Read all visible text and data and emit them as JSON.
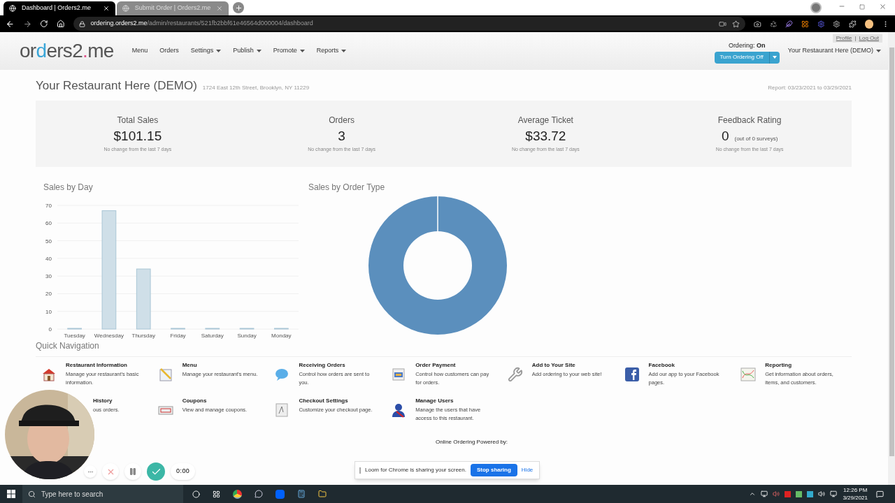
{
  "browser": {
    "tabs": [
      {
        "title": "Dashboard | Orders2.me",
        "selected": true
      },
      {
        "title": "Submit Order | Orders2.me",
        "selected": false
      }
    ],
    "url_host": "ordering.orders2.me",
    "url_path": "/admin/restaurants/521fb2bbf61e46564d000004/dashboard"
  },
  "header": {
    "logo_parts": [
      "or",
      "d",
      "ers2",
      ".",
      "me"
    ],
    "nav": [
      "Menu",
      "Orders",
      "Settings",
      "Publish",
      "Promote",
      "Reports"
    ],
    "nav_dropdown": [
      false,
      false,
      true,
      true,
      true,
      true
    ],
    "account_links": [
      "Profile",
      "Log Out"
    ],
    "account_separator": "|",
    "ordering_label": "Ordering:",
    "ordering_state": "On",
    "toggle_button": "Turn Ordering Off",
    "restaurant_menu": "Your Restaurant Here (DEMO)"
  },
  "restaurant": {
    "name": "Your Restaurant Here (DEMO)",
    "address": "1724 East 12th Street, Brooklyn, NY 11229",
    "report_range": "Report: 03/23/2021 to 03/29/2021"
  },
  "stats": [
    {
      "label": "Total Sales",
      "value": "$101.15",
      "note": "No change from the last 7 days"
    },
    {
      "label": "Orders",
      "value": "3",
      "note": "No change from the last 7 days"
    },
    {
      "label": "Average Ticket",
      "value": "$33.72",
      "note": "No change from the last 7 days"
    },
    {
      "label": "Feedback Rating",
      "value": "0",
      "extra": "(out of 0 surveys)",
      "note": "No change from the last 7 days"
    }
  ],
  "sales_by_day": {
    "title": "Sales by Day",
    "chart_data": {
      "type": "bar",
      "categories": [
        "Tuesday",
        "Wednesday",
        "Thursday",
        "Friday",
        "Saturday",
        "Sunday",
        "Monday"
      ],
      "values": [
        0,
        67,
        34,
        0,
        0,
        0,
        0
      ],
      "ylim": [
        0,
        70
      ],
      "grid": true,
      "yticks": [
        0,
        10,
        20,
        30,
        40,
        50,
        60,
        70
      ]
    }
  },
  "sales_by_order_type": {
    "title": "Sales by Order Type"
  },
  "quick_navigation": {
    "title": "Quick Navigation",
    "items": [
      {
        "title": "Restaurant Information",
        "description": "Manage your restaurant's basic information."
      },
      {
        "title": "Menu",
        "description": "Manage your restaurant's menu."
      },
      {
        "title": "Receiving Orders",
        "description": "Control how orders are sent to you."
      },
      {
        "title": "Order Payment",
        "description": "Control how customers can pay for orders."
      },
      {
        "title": "Add to Your Site",
        "description": "Add ordering to your web site!"
      },
      {
        "title": "Facebook",
        "description": "Add our app to your Facebook pages."
      },
      {
        "title": "Reporting",
        "description": "Get information about orders, items, and customers."
      },
      {
        "title": "History",
        "description": "ous orders."
      },
      {
        "title": "Coupons",
        "description": "View and manage coupons."
      },
      {
        "title": "Checkout Settings",
        "description": "Customize your checkout page."
      },
      {
        "title": "Manage Users",
        "description": "Manage the users that have access to this restaurant."
      }
    ]
  },
  "powered_by": "Online Ordering Powered by:",
  "recorder": {
    "timer": "0:00"
  },
  "loom_bar": {
    "message": "Loom for Chrome is sharing your screen.",
    "stop_button": "Stop sharing",
    "hide_link": "Hide"
  },
  "taskbar": {
    "search_placeholder": "Type here to search",
    "time": "12:26 PM",
    "date": "3/29/2021"
  }
}
